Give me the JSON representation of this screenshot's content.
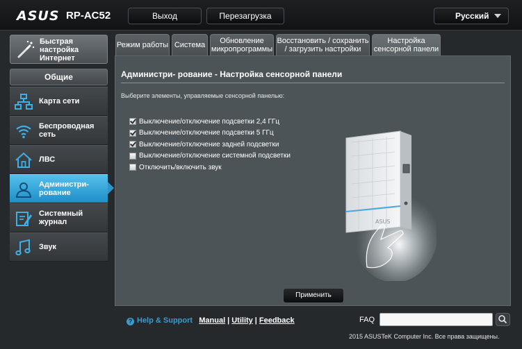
{
  "header": {
    "logo": "ASUS",
    "model": "RP-AC52",
    "logout_label": "Выход",
    "reboot_label": "Перезагрузка",
    "language": "Русский"
  },
  "sidebar": {
    "quick_setup": [
      "Быстрая",
      "настройка",
      "Интернет"
    ],
    "general_header": "Общие",
    "items": [
      {
        "label": "Карта сети",
        "icon": "network-map-icon"
      },
      {
        "label": "Беспроводная сеть",
        "icon": "wireless-icon"
      },
      {
        "label": "ЛВС",
        "icon": "lan-house-icon"
      },
      {
        "label": "Администри- рование",
        "icon": "admin-user-icon",
        "active": true
      },
      {
        "label": "Системный журнал",
        "icon": "system-log-icon"
      },
      {
        "label": "Звук",
        "icon": "music-note-icon"
      }
    ]
  },
  "tabs": [
    {
      "label": "Режим работы"
    },
    {
      "label": "Система"
    },
    {
      "label": "Обновление микропрограммы"
    },
    {
      "label": "Восстановить / сохранить / загрузить настройки"
    },
    {
      "label": "Настройка сенсорной панели",
      "active": true
    }
  ],
  "main": {
    "title": "Администри- рование - Настройка сенсорной панели",
    "description": "Выберите элементы, управляемые сенсорной панелью:",
    "options": [
      {
        "label": "Выключение/отключение подсветки 2,4 ГГц",
        "checked": true
      },
      {
        "label": "Выключение/отключение подсветки 5 ГГц",
        "checked": true
      },
      {
        "label": "Выключение/отключение задней подсветки",
        "checked": true
      },
      {
        "label": "Выключение/отключение системной подсветки",
        "checked": false
      },
      {
        "label": "Отключить/включить звук",
        "checked": false
      }
    ],
    "device_logo": "ASUS",
    "apply_label": "Применить"
  },
  "footer": {
    "help_support": "Help & Support",
    "manual": "Manual",
    "utility": "Utility",
    "feedback": "Feedback",
    "faq_label": "FAQ",
    "copyright": "2015 ASUSTeK Computer Inc. Все права защищены."
  },
  "colors": {
    "accent_blue": "#2a96cd",
    "panel_bg": "#4d5457",
    "page_bg": "#26292b"
  }
}
